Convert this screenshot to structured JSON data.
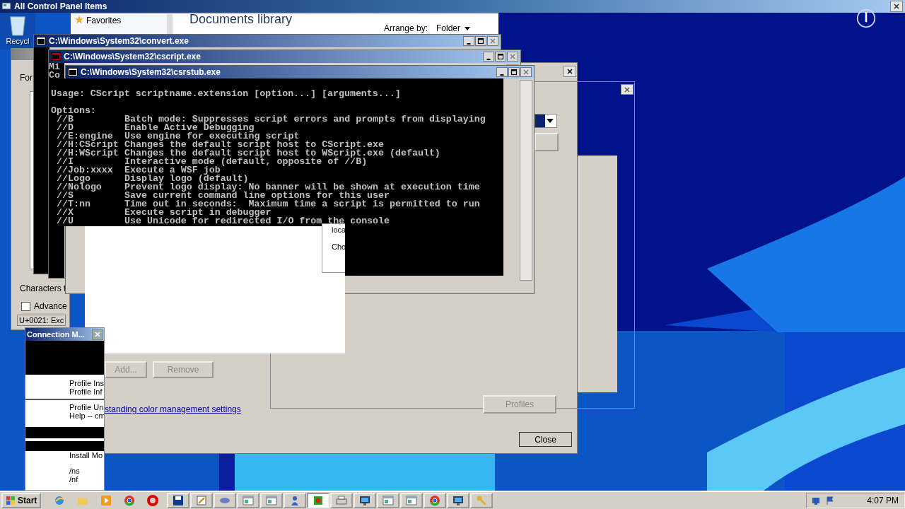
{
  "title_bar": {
    "title": "All Control Panel Items"
  },
  "desktop_icon": {
    "label": "Recycl"
  },
  "explorer": {
    "favorites": "Favorites",
    "heading": "Documents library",
    "arrange_label": "Arrange by:",
    "arrange_value": "Folder"
  },
  "charmap": {
    "font_label": "For",
    "chars_label": "Characters t",
    "advanced": {
      "label": "Advance",
      "checked": false
    },
    "status": "U+0021: Exc"
  },
  "consoles": [
    {
      "title": "C:\\Windows\\System32\\convert.exe"
    },
    {
      "title": "C:\\Windows\\System32\\cscript.exe",
      "lines": [
        "Mi",
        "Co"
      ]
    },
    {
      "title": "C:\\Windows\\System32\\csrstub.exe",
      "usage": "Usage: CScript scriptname.extension [option...] [arguments...]",
      "options_heading": "Options:",
      "options": [
        {
          "option": "//B",
          "text": "Batch mode: Suppresses script errors and prompts from displaying"
        },
        {
          "option": "//D",
          "text": "Enable Active Debugging"
        },
        {
          "option": "//E:engine",
          "text": "Use engine for executing script"
        },
        {
          "option": "//H:CScript",
          "text": "Changes the default script host to CScript.exe"
        },
        {
          "option": "//H:WScript",
          "text": "Changes the default script host to WScript.exe (default)"
        },
        {
          "option": "//I",
          "text": "Interactive mode (default, opposite of //B)"
        },
        {
          "option": "//Job:xxxx",
          "text": "Execute a WSF job"
        },
        {
          "option": "//Logo",
          "text": "Display logo (default)"
        },
        {
          "option": "//Nologo",
          "text": "Prevent logo display: No banner will be shown at execution time"
        },
        {
          "option": "//S",
          "text": "Save current command line options for this user"
        },
        {
          "option": "//T:nn",
          "text": "Time out in seconds:  Maximum time a script is permitted to run"
        },
        {
          "option": "//X",
          "text": "Execute script in debugger"
        },
        {
          "option": "//U",
          "text": "Use Unicode for redirected I/O from the console"
        }
      ]
    }
  ],
  "color_dialog": {
    "fragments": [
      "loca",
      "Cho"
    ],
    "buttons": [
      {
        "label": "Add...",
        "disabled": true
      },
      {
        "label": "Remove",
        "disabled": true
      }
    ],
    "link": "standing color management settings",
    "profiles_button": {
      "label": "Profiles",
      "disabled": true
    },
    "close_button": "Close"
  },
  "connection_manager": {
    "title": "Connection M...",
    "lines": [
      "Profile Ins",
      "Profile Inf",
      "Profile Un",
      "Help -- cm",
      "Install Mo",
      "/ns",
      "/nf"
    ]
  },
  "taskbar": {
    "start": "Start",
    "clock": "4:07 PM",
    "quick_launch": [
      {
        "kind": "globe"
      },
      {
        "kind": "folder"
      },
      {
        "kind": "play"
      },
      {
        "kind": "chrome"
      },
      {
        "kind": "opera"
      }
    ],
    "tasks": [
      {
        "kind": "disk",
        "selected": false
      },
      {
        "kind": "tool",
        "selected": false
      },
      {
        "kind": "console",
        "selected": false
      },
      {
        "kind": "window",
        "selected": false
      },
      {
        "kind": "window",
        "selected": false
      },
      {
        "kind": "people",
        "selected": false
      },
      {
        "kind": "app",
        "selected": true
      },
      {
        "kind": "printer",
        "selected": false
      },
      {
        "kind": "monitor",
        "selected": false
      },
      {
        "kind": "window",
        "selected": false
      },
      {
        "kind": "window",
        "selected": false
      },
      {
        "kind": "chrome",
        "selected": false
      },
      {
        "kind": "monitor",
        "selected": false
      },
      {
        "kind": "key",
        "selected": false
      }
    ]
  }
}
